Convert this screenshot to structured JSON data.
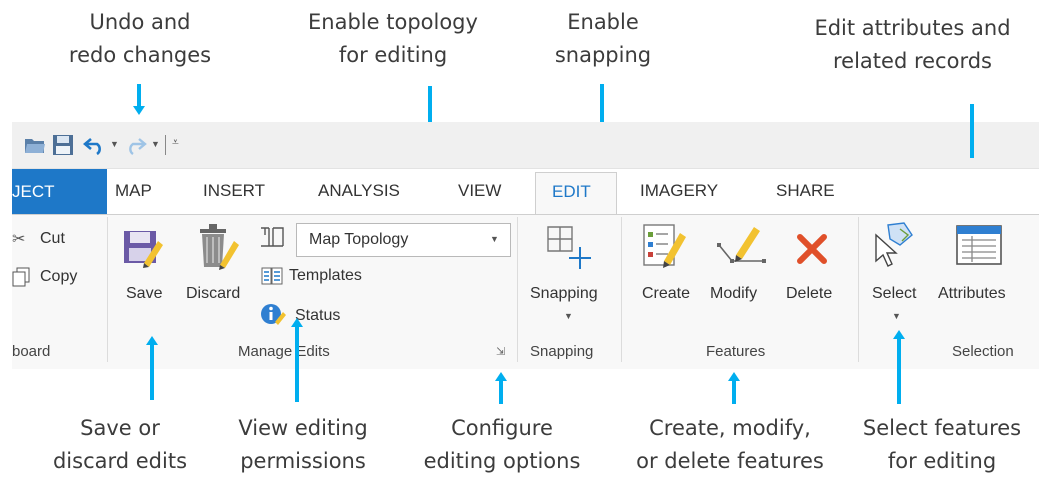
{
  "callouts": {
    "undo": [
      "Undo and",
      "redo changes"
    ],
    "topology": [
      "Enable topology",
      "for editing"
    ],
    "snapping": [
      "Enable",
      "snapping"
    ],
    "attributes": [
      "Edit attributes and",
      "related records"
    ],
    "save": [
      "Save or",
      "discard edits"
    ],
    "permissions": [
      "View editing",
      "permissions"
    ],
    "configure": [
      "Configure",
      "editing options"
    ],
    "create": [
      "Create, modify,",
      "or delete features"
    ],
    "select": [
      "Select features",
      "for editing"
    ]
  },
  "tabs": {
    "project": "JECT",
    "map": "MAP",
    "insert": "INSERT",
    "analysis": "ANALYSIS",
    "view": "VIEW",
    "edit": "EDIT",
    "imagery": "IMAGERY",
    "share": "SHARE"
  },
  "clipboard": {
    "cut": "Cut",
    "copy": "Copy",
    "label": "board"
  },
  "manage_edits": {
    "save": "Save",
    "discard": "Discard",
    "topology_value": "Map Topology",
    "templates": "Templates",
    "status": "Status",
    "label": "Manage Edits"
  },
  "snapping": {
    "button": "Snapping",
    "label": "Snapping"
  },
  "features": {
    "create": "Create",
    "modify": "Modify",
    "delete": "Delete",
    "label": "Features"
  },
  "selection": {
    "select": "Select",
    "attributes": "Attributes",
    "label": "Selection"
  },
  "colors": {
    "accent": "#00aeef",
    "project_tab": "#1e78c8",
    "delete": "#e0502a"
  }
}
